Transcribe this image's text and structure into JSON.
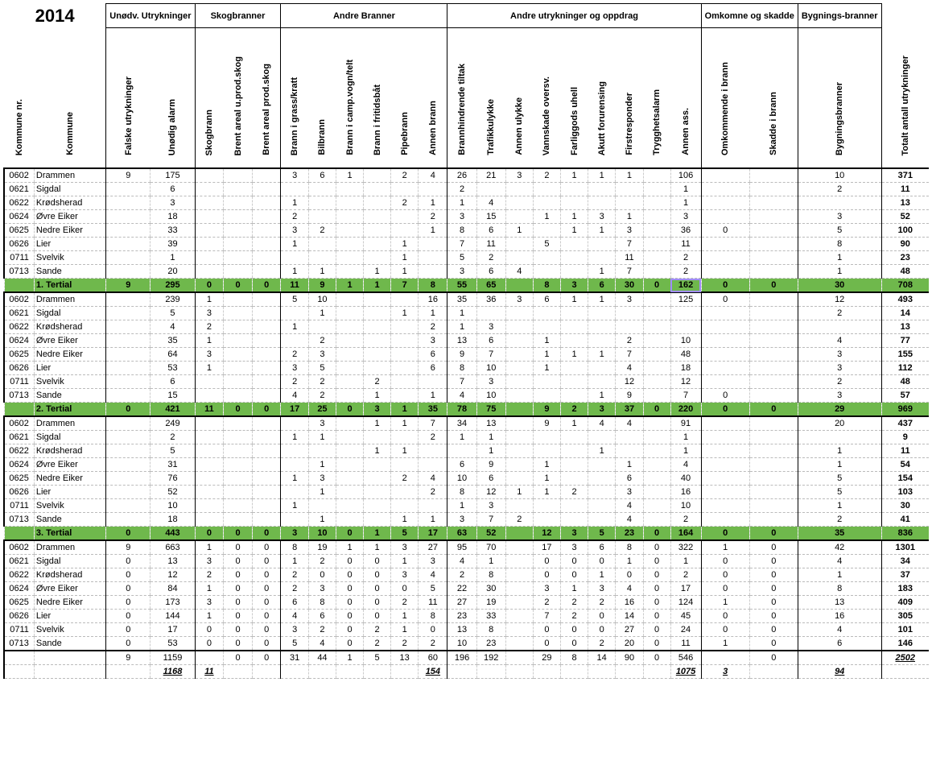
{
  "year": "2014",
  "groups": [
    "Unødv. Utrykninger",
    "Skogbranner",
    "Andre Branner",
    "Andre utrykninger og oppdrag",
    "Omkomne og skadde",
    "Bygnings-branner"
  ],
  "columns": [
    "Kommune nr.",
    "Kommune",
    "Falske utrykninger",
    "Unødig alarm",
    "Skogbrann",
    "Brent areal u.prod.skog",
    "Brent areal prod.skog",
    "Brann i grass/kratt",
    "Bilbrann",
    "Brann i camp.vogn/telt",
    "Brann i fritidsbåt",
    "Pipebrann",
    "Annen brann",
    "Brannhindrende tiltak",
    "Trafikkulykke",
    "Annen ulykke",
    "Vannskade oversv.",
    "Farliggods uhell",
    "Akutt forurensing",
    "Firstresponder",
    "Trygghetsalarm",
    "Annen ass.",
    "Omkommende i brann",
    "Skadde i brann",
    "Bygningsbranner",
    "Totalt antall utrykninger"
  ],
  "sections": [
    {
      "label": "1. Tertial",
      "rows": [
        {
          "cells": [
            "0602",
            "Drammen",
            "9",
            "175",
            "",
            "",
            "",
            "3",
            "6",
            "1",
            "",
            "2",
            "4",
            "26",
            "21",
            "3",
            "2",
            "1",
            "1",
            "1",
            "",
            "106",
            "",
            "",
            "10",
            "371"
          ]
        },
        {
          "cells": [
            "0621",
            "Sigdal",
            "",
            "6",
            "",
            "",
            "",
            "",
            "",
            "",
            "",
            "",
            "",
            "2",
            "",
            "",
            "",
            "",
            "",
            "",
            "",
            "1",
            "",
            "",
            "2",
            "11"
          ]
        },
        {
          "cells": [
            "0622",
            "Krødsherad",
            "",
            "3",
            "",
            "",
            "",
            "1",
            "",
            "",
            "",
            "2",
            "1",
            "1",
            "4",
            "",
            "",
            "",
            "",
            "",
            "",
            "1",
            "",
            "",
            "",
            "13"
          ]
        },
        {
          "cells": [
            "0624",
            "Øvre Eiker",
            "",
            "18",
            "",
            "",
            "",
            "2",
            "",
            "",
            "",
            "",
            "2",
            "3",
            "15",
            "",
            "1",
            "1",
            "3",
            "1",
            "",
            "3",
            "",
            "",
            "3",
            "52"
          ]
        },
        {
          "cells": [
            "0625",
            "Nedre Eiker",
            "",
            "33",
            "",
            "",
            "",
            "3",
            "2",
            "",
            "",
            "",
            "1",
            "8",
            "6",
            "1",
            "",
            "1",
            "1",
            "3",
            "",
            "36",
            "0",
            "",
            "5",
            "100"
          ]
        },
        {
          "cells": [
            "0626",
            "Lier",
            "",
            "39",
            "",
            "",
            "",
            "1",
            "",
            "",
            "",
            "1",
            "",
            "7",
            "11",
            "",
            "5",
            "",
            "",
            "7",
            "",
            "11",
            "",
            "",
            "8",
            "90"
          ]
        },
        {
          "cells": [
            "0711",
            "Svelvik",
            "",
            "1",
            "",
            "",
            "",
            "",
            "",
            "",
            "",
            "1",
            "",
            "5",
            "2",
            "",
            "",
            "",
            "",
            "11",
            "",
            "2",
            "",
            "",
            "1",
            "23"
          ]
        },
        {
          "cells": [
            "0713",
            "Sande",
            "",
            "20",
            "",
            "",
            "",
            "1",
            "1",
            "",
            "1",
            "1",
            "",
            "3",
            "6",
            "4",
            "",
            "",
            "1",
            "7",
            "",
            "2",
            "",
            "",
            "1",
            "48"
          ]
        }
      ],
      "subtotal": [
        "",
        "1. Tertial",
        "9",
        "295",
        "0",
        "0",
        "0",
        "11",
        "9",
        "1",
        "1",
        "7",
        "8",
        "55",
        "65",
        "",
        "8",
        "3",
        "6",
        "30",
        "0",
        "162",
        "0",
        "0",
        "30",
        "708"
      ]
    },
    {
      "label": "2. Tertial",
      "rows": [
        {
          "cells": [
            "0602",
            "Drammen",
            "",
            "239",
            "1",
            "",
            "",
            "5",
            "10",
            "",
            "",
            "",
            "16",
            "35",
            "36",
            "3",
            "6",
            "1",
            "1",
            "3",
            "",
            "125",
            "0",
            "",
            "12",
            "493"
          ]
        },
        {
          "cells": [
            "0621",
            "Sigdal",
            "",
            "5",
            "3",
            "",
            "",
            "",
            "1",
            "",
            "",
            "1",
            "1",
            "1",
            "",
            "",
            "",
            "",
            "",
            "",
            "",
            "",
            "",
            "",
            "2",
            "14"
          ]
        },
        {
          "cells": [
            "0622",
            "Krødsherad",
            "",
            "4",
            "2",
            "",
            "",
            "1",
            "",
            "",
            "",
            "",
            "2",
            "1",
            "3",
            "",
            "",
            "",
            "",
            "",
            "",
            "",
            "",
            "",
            "",
            "13"
          ]
        },
        {
          "cells": [
            "0624",
            "Øvre Eiker",
            "",
            "35",
            "1",
            "",
            "",
            "",
            "2",
            "",
            "",
            "",
            "3",
            "13",
            "6",
            "",
            "1",
            "",
            "",
            "2",
            "",
            "10",
            "",
            "",
            "4",
            "77"
          ]
        },
        {
          "cells": [
            "0625",
            "Nedre Eiker",
            "",
            "64",
            "3",
            "",
            "",
            "2",
            "3",
            "",
            "",
            "",
            "6",
            "9",
            "7",
            "",
            "1",
            "1",
            "1",
            "7",
            "",
            "48",
            "",
            "",
            "3",
            "155"
          ]
        },
        {
          "cells": [
            "0626",
            "Lier",
            "",
            "53",
            "1",
            "",
            "",
            "3",
            "5",
            "",
            "",
            "",
            "6",
            "8",
            "10",
            "",
            "1",
            "",
            "",
            "4",
            "",
            "18",
            "",
            "",
            "3",
            "112"
          ]
        },
        {
          "cells": [
            "0711",
            "Svelvik",
            "",
            "6",
            "",
            "",
            "",
            "2",
            "2",
            "",
            "2",
            "",
            "",
            "7",
            "3",
            "",
            "",
            "",
            "",
            "12",
            "",
            "12",
            "",
            "",
            "2",
            "48"
          ]
        },
        {
          "cells": [
            "0713",
            "Sande",
            "",
            "15",
            "",
            "",
            "",
            "4",
            "2",
            "",
            "1",
            "",
            "1",
            "4",
            "10",
            "",
            "",
            "",
            "1",
            "9",
            "",
            "7",
            "0",
            "",
            "3",
            "57"
          ]
        }
      ],
      "subtotal": [
        "",
        "2. Tertial",
        "0",
        "421",
        "11",
        "0",
        "0",
        "17",
        "25",
        "0",
        "3",
        "1",
        "35",
        "78",
        "75",
        "",
        "9",
        "2",
        "3",
        "37",
        "0",
        "220",
        "0",
        "0",
        "29",
        "969"
      ]
    },
    {
      "label": "3. Tertial",
      "rows": [
        {
          "cells": [
            "0602",
            "Drammen",
            "",
            "249",
            "",
            "",
            "",
            "",
            "3",
            "",
            "1",
            "1",
            "7",
            "34",
            "13",
            "",
            "9",
            "1",
            "4",
            "4",
            "",
            "91",
            "",
            "",
            "20",
            "437"
          ]
        },
        {
          "cells": [
            "0621",
            "Sigdal",
            "",
            "2",
            "",
            "",
            "",
            "1",
            "1",
            "",
            "",
            "",
            "2",
            "1",
            "1",
            "",
            "",
            "",
            "",
            "",
            "",
            "1",
            "",
            "",
            "",
            "9"
          ]
        },
        {
          "cells": [
            "0622",
            "Krødsherad",
            "",
            "5",
            "",
            "",
            "",
            "",
            "",
            "",
            "1",
            "1",
            "",
            "",
            "1",
            "",
            "",
            "",
            "1",
            "",
            "",
            "1",
            "",
            "",
            "1",
            "11"
          ]
        },
        {
          "cells": [
            "0624",
            "Øvre Eiker",
            "",
            "31",
            "",
            "",
            "",
            "",
            "1",
            "",
            "",
            "",
            "",
            "6",
            "9",
            "",
            "1",
            "",
            "",
            "1",
            "",
            "4",
            "",
            "",
            "1",
            "54"
          ]
        },
        {
          "cells": [
            "0625",
            "Nedre Eiker",
            "",
            "76",
            "",
            "",
            "",
            "1",
            "3",
            "",
            "",
            "2",
            "4",
            "10",
            "6",
            "",
            "1",
            "",
            "",
            "6",
            "",
            "40",
            "",
            "",
            "5",
            "154"
          ]
        },
        {
          "cells": [
            "0626",
            "Lier",
            "",
            "52",
            "",
            "",
            "",
            "",
            "1",
            "",
            "",
            "",
            "2",
            "8",
            "12",
            "1",
            "1",
            "2",
            "",
            "3",
            "",
            "16",
            "",
            "",
            "5",
            "103"
          ]
        },
        {
          "cells": [
            "0711",
            "Svelvik",
            "",
            "10",
            "",
            "",
            "",
            "1",
            "",
            "",
            "",
            "",
            "",
            "1",
            "3",
            "",
            "",
            "",
            "",
            "4",
            "",
            "10",
            "",
            "",
            "1",
            "30"
          ]
        },
        {
          "cells": [
            "0713",
            "Sande",
            "",
            "18",
            "",
            "",
            "",
            "",
            "1",
            "",
            "",
            "1",
            "1",
            "3",
            "7",
            "2",
            "",
            "",
            "",
            "4",
            "",
            "2",
            "",
            "",
            "2",
            "41"
          ]
        }
      ],
      "subtotal": [
        "",
        "3. Tertial",
        "0",
        "443",
        "0",
        "0",
        "0",
        "3",
        "10",
        "0",
        "1",
        "5",
        "17",
        "63",
        "52",
        "",
        "12",
        "3",
        "5",
        "23",
        "0",
        "164",
        "0",
        "0",
        "35",
        "836"
      ]
    }
  ],
  "totals": [
    {
      "cells": [
        "0602",
        "Drammen",
        "9",
        "663",
        "1",
        "0",
        "0",
        "8",
        "19",
        "1",
        "1",
        "3",
        "27",
        "95",
        "70",
        "",
        "17",
        "3",
        "6",
        "8",
        "0",
        "322",
        "1",
        "0",
        "42",
        "1301"
      ]
    },
    {
      "cells": [
        "0621",
        "Sigdal",
        "0",
        "13",
        "3",
        "0",
        "0",
        "1",
        "2",
        "0",
        "0",
        "1",
        "3",
        "4",
        "1",
        "",
        "0",
        "0",
        "0",
        "1",
        "0",
        "1",
        "0",
        "0",
        "4",
        "34"
      ]
    },
    {
      "cells": [
        "0622",
        "Krødsherad",
        "0",
        "12",
        "2",
        "0",
        "0",
        "2",
        "0",
        "0",
        "0",
        "3",
        "4",
        "2",
        "8",
        "",
        "0",
        "0",
        "1",
        "0",
        "0",
        "2",
        "0",
        "0",
        "1",
        "37"
      ]
    },
    {
      "cells": [
        "0624",
        "Øvre Eiker",
        "0",
        "84",
        "1",
        "0",
        "0",
        "2",
        "3",
        "0",
        "0",
        "0",
        "5",
        "22",
        "30",
        "",
        "3",
        "1",
        "3",
        "4",
        "0",
        "17",
        "0",
        "0",
        "8",
        "183"
      ]
    },
    {
      "cells": [
        "0625",
        "Nedre Eiker",
        "0",
        "173",
        "3",
        "0",
        "0",
        "6",
        "8",
        "0",
        "0",
        "2",
        "11",
        "27",
        "19",
        "",
        "2",
        "2",
        "2",
        "16",
        "0",
        "124",
        "1",
        "0",
        "13",
        "409"
      ]
    },
    {
      "cells": [
        "0626",
        "Lier",
        "0",
        "144",
        "1",
        "0",
        "0",
        "4",
        "6",
        "0",
        "0",
        "1",
        "8",
        "23",
        "33",
        "",
        "7",
        "2",
        "0",
        "14",
        "0",
        "45",
        "0",
        "0",
        "16",
        "305"
      ]
    },
    {
      "cells": [
        "0711",
        "Svelvik",
        "0",
        "17",
        "0",
        "0",
        "0",
        "3",
        "2",
        "0",
        "2",
        "1",
        "0",
        "13",
        "8",
        "",
        "0",
        "0",
        "0",
        "27",
        "0",
        "24",
        "0",
        "0",
        "4",
        "101"
      ]
    },
    {
      "cells": [
        "0713",
        "Sande",
        "0",
        "53",
        "0",
        "0",
        "0",
        "5",
        "4",
        "0",
        "2",
        "2",
        "2",
        "10",
        "23",
        "",
        "0",
        "0",
        "2",
        "20",
        "0",
        "11",
        "1",
        "0",
        "6",
        "146"
      ]
    }
  ],
  "sum_row": [
    "",
    "",
    "9",
    "1159",
    "",
    "0",
    "0",
    "31",
    "44",
    "1",
    "5",
    "13",
    "60",
    "196",
    "192",
    "",
    "29",
    "8",
    "14",
    "90",
    "0",
    "546",
    "",
    "0",
    "",
    "2502"
  ],
  "grand_row": [
    "",
    "",
    "",
    "1168",
    "11",
    "",
    "",
    "",
    "",
    "",
    "",
    "",
    "154",
    "",
    "",
    "",
    "",
    "",
    "",
    "",
    "",
    "1075",
    "3",
    "",
    "94",
    ""
  ]
}
